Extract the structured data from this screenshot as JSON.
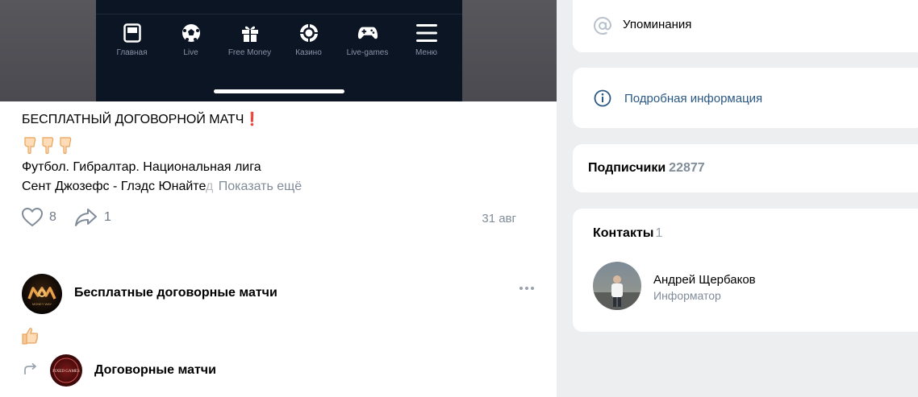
{
  "phone_tabbar": {
    "items": [
      {
        "label": "Главная",
        "icon": "home-icon"
      },
      {
        "label": "Live",
        "icon": "soccer-ball-icon"
      },
      {
        "label": "Free Money",
        "icon": "gift-icon"
      },
      {
        "label": "Казино",
        "icon": "casino-chip-icon"
      },
      {
        "label": "Live-games",
        "icon": "gamepad-icon"
      },
      {
        "label": "Меню",
        "icon": "menu-icon"
      }
    ]
  },
  "post": {
    "title": "БЕСПЛАТНЫЙ ДОГОВОРНОЙ МАТЧ",
    "title_emoji": "❗",
    "line1": "Футбол. Гибралтар. Национальная лига",
    "line2_visible": "Сент Джозефс - Глэдс Юнайте",
    "line2_faded": "д",
    "show_more": "Показать ещё",
    "likes": "8",
    "shares": "1",
    "date": "31 авг"
  },
  "comment": {
    "author": "Бесплатные договорные матчи",
    "avatar_text": "MONEY WAY",
    "repost_author": "Договорные матчи",
    "repost_avatar_text": "FIXED GAMES"
  },
  "sidebar": {
    "mentions": "Упоминания",
    "details": "Подробная информация",
    "subscribers_label": "Подписчики",
    "subscribers_count": "22877",
    "contacts_label": "Контакты",
    "contacts_count": "1",
    "contact": {
      "name": "Андрей Щербаков",
      "role": "Информатор"
    }
  },
  "colors": {
    "link": "#2a5885",
    "muted": "#818c99",
    "phone_bg": "#0c1524",
    "page_bg": "#edeef0"
  }
}
